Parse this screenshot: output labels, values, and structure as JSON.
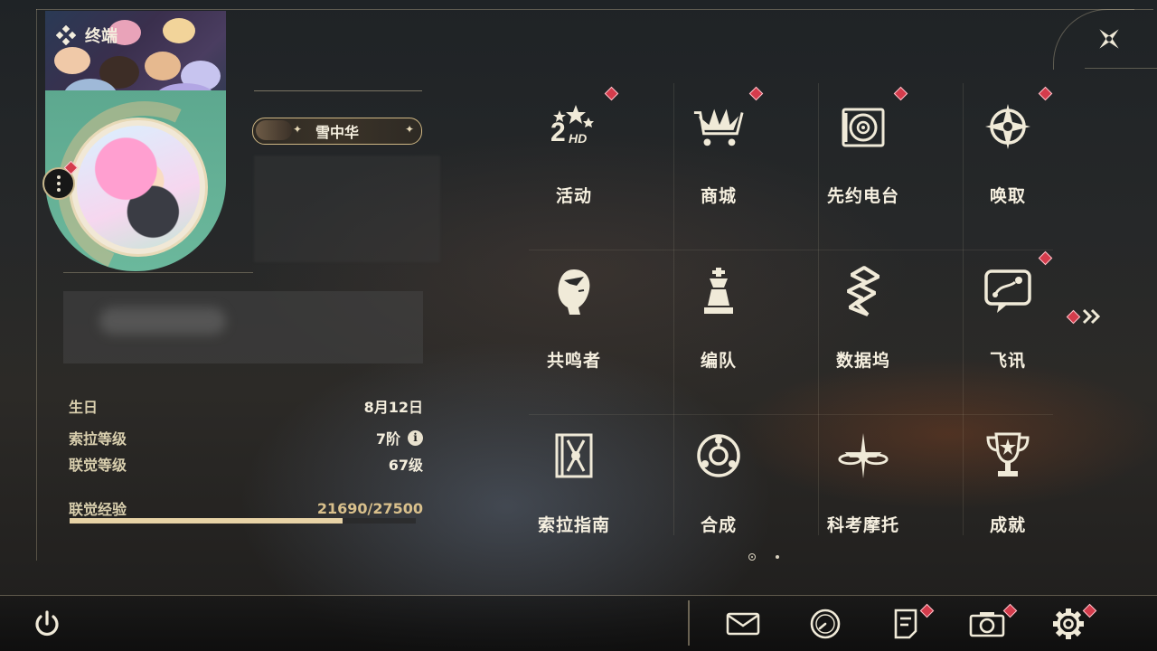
{
  "header": {
    "title": "终端"
  },
  "profile": {
    "name": "雪中华",
    "stats": {
      "birthday_label": "生日",
      "birthday_value": "8月12日",
      "sola_level_label": "索拉等级",
      "sola_level_value": "7阶",
      "synesthesia_label": "联觉等级",
      "synesthesia_value": "67级",
      "xp_label": "联觉经验",
      "xp_value": "21690/27500",
      "xp_current": 21690,
      "xp_max": 27500
    }
  },
  "menu": {
    "items": [
      {
        "label": "活动",
        "icon": "event-2hd-icon",
        "badge": true
      },
      {
        "label": "商城",
        "icon": "shop-cart-icon",
        "badge": true
      },
      {
        "label": "先约电台",
        "icon": "radio-record-icon",
        "badge": true
      },
      {
        "label": "唤取",
        "icon": "summon-compass-icon",
        "badge": true
      },
      {
        "label": "共鸣者",
        "icon": "resonator-head-icon",
        "badge": false
      },
      {
        "label": "编队",
        "icon": "team-chess-icon",
        "badge": false
      },
      {
        "label": "数据坞",
        "icon": "data-dock-icon",
        "badge": false
      },
      {
        "label": "飞讯",
        "icon": "message-chat-icon",
        "badge": true
      },
      {
        "label": "索拉指南",
        "icon": "guide-book-icon",
        "badge": false
      },
      {
        "label": "合成",
        "icon": "synthesis-icon",
        "badge": false
      },
      {
        "label": "科考摩托",
        "icon": "motorbike-icon",
        "badge": false
      },
      {
        "label": "成就",
        "icon": "trophy-icon",
        "badge": false
      }
    ]
  },
  "pagination": {
    "current": 1,
    "total": 2
  },
  "bottom_bar": {
    "buttons": [
      {
        "icon": "power-icon",
        "badge": false
      },
      {
        "icon": "mail-icon",
        "badge": false
      },
      {
        "icon": "clock-icon",
        "badge": false
      },
      {
        "icon": "notice-icon",
        "badge": true
      },
      {
        "icon": "camera-icon",
        "badge": true
      },
      {
        "icon": "settings-icon",
        "badge": true
      }
    ]
  },
  "colors": {
    "accent_gold": "#e8d3a6",
    "badge_red": "#d43c4c",
    "text_light": "#f6f0e0"
  }
}
